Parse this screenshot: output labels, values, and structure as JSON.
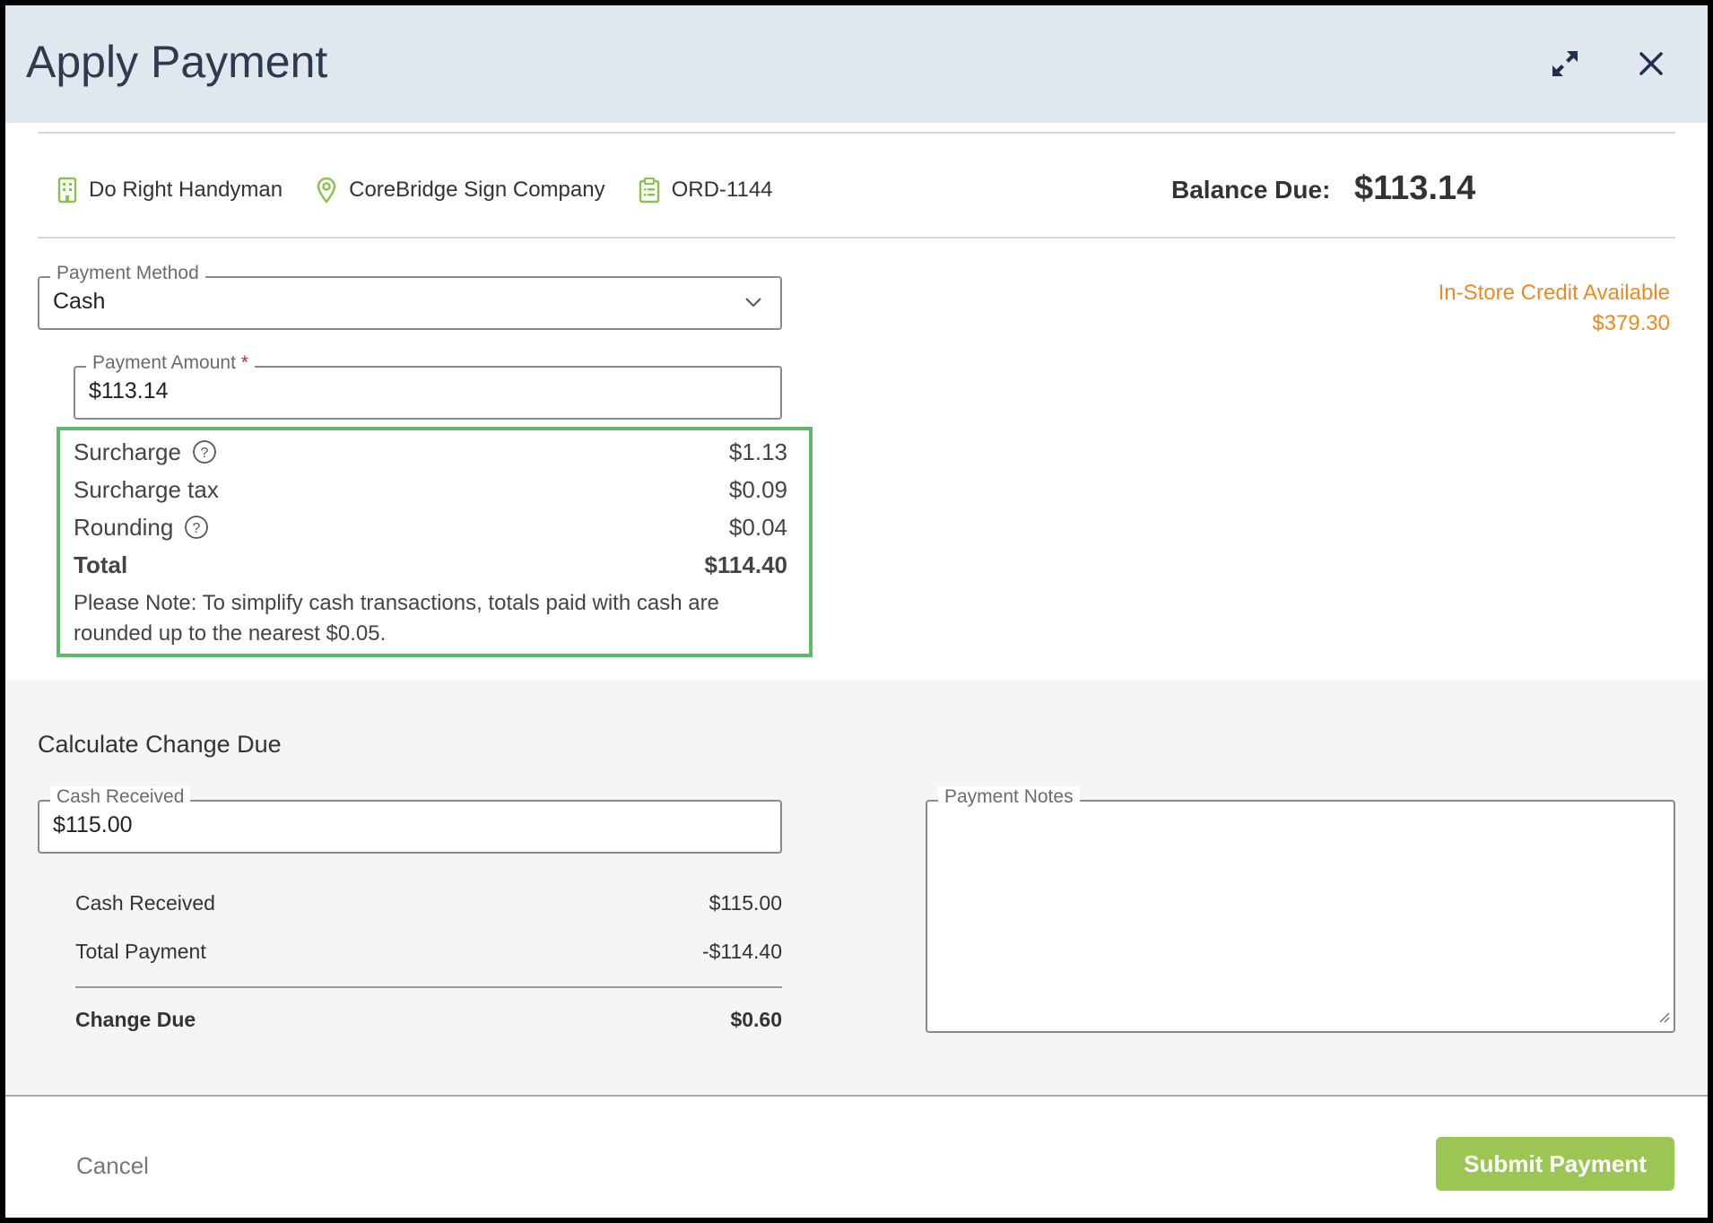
{
  "header": {
    "title": "Apply Payment",
    "expand_icon": "expand-icon",
    "close_icon": "close-icon"
  },
  "info": {
    "company": "Do Right Handyman",
    "location": "CoreBridge Sign Company",
    "order": "ORD-1144",
    "balance_label": "Balance Due:",
    "balance_value": "$113.14"
  },
  "payment_method": {
    "label": "Payment Method",
    "value": "Cash"
  },
  "credit": {
    "label": "In-Store Credit Available",
    "value": "$379.30"
  },
  "payment_amount": {
    "label": "Payment Amount",
    "required_mark": "*",
    "value": "$113.14"
  },
  "summary": {
    "surcharge_label": "Surcharge",
    "surcharge_value": "$1.13",
    "surcharge_tax_label": "Surcharge tax",
    "surcharge_tax_value": "$0.09",
    "rounding_label": "Rounding",
    "rounding_value": "$0.04",
    "total_label": "Total",
    "total_value": "$114.40",
    "note": "Please Note: To simplify cash transactions, totals paid with cash are rounded up to the nearest $0.05."
  },
  "change": {
    "title": "Calculate Change Due",
    "cash_received_field_label": "Cash Received",
    "cash_received_field_value": "$115.00",
    "cash_received_label": "Cash Received",
    "cash_received_value": "$115.00",
    "total_payment_label": "Total Payment",
    "total_payment_value": "-$114.40",
    "change_due_label": "Change Due",
    "change_due_value": "$0.60"
  },
  "notes": {
    "label": "Payment Notes",
    "value": ""
  },
  "footer": {
    "cancel": "Cancel",
    "submit": "Submit Payment"
  },
  "colors": {
    "header_bg": "#e1e7ef",
    "accent_green": "#9bc654",
    "highlight_box": "#5cbb6b",
    "credit_orange": "#eb8a25",
    "icon_green": "#8cc152"
  }
}
